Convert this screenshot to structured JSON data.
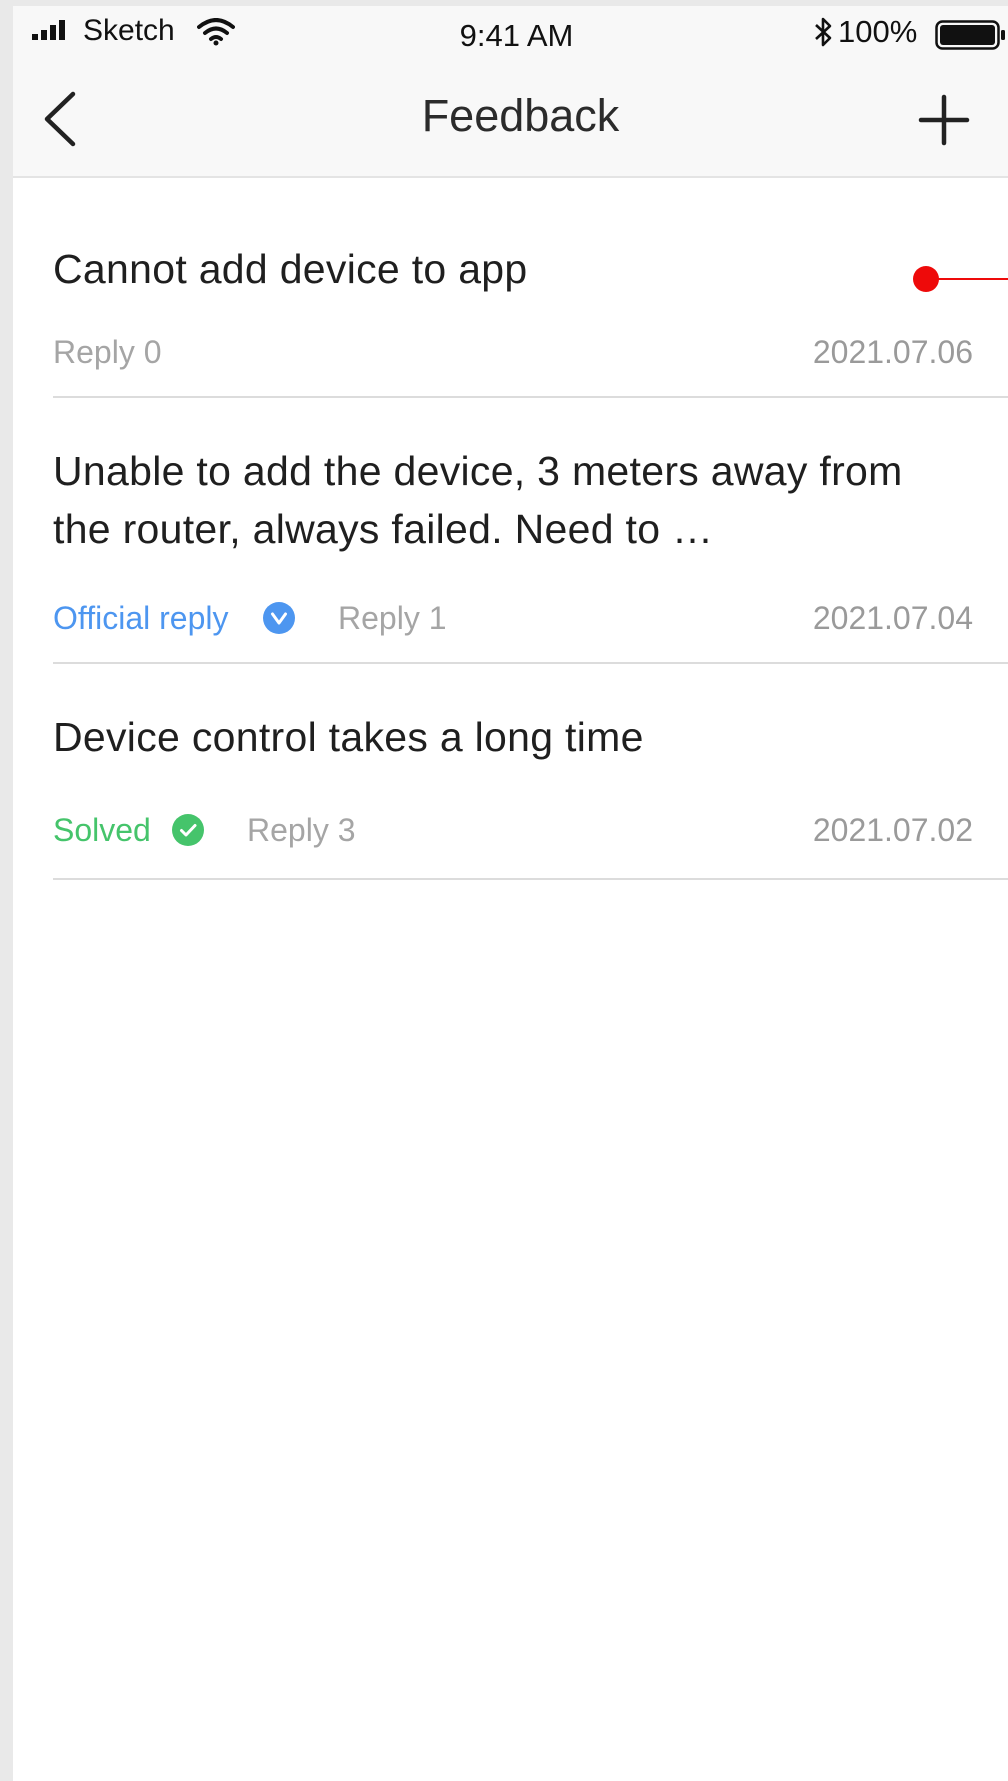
{
  "status_bar": {
    "carrier": "Sketch",
    "time": "9:41 AM",
    "battery": "100%"
  },
  "nav": {
    "title": "Feedback"
  },
  "feedback": [
    {
      "title": "Cannot add device to app",
      "reply": "Reply 0",
      "date": "2021.07.06",
      "unread": true
    },
    {
      "title": "Unable to add the device, 3 meters away from the router, always failed. Need to …",
      "status": "Official reply",
      "status_icon": "check-badge-icon",
      "reply": "Reply 1",
      "date": "2021.07.04"
    },
    {
      "title": "Device control takes a long time",
      "status": "Solved",
      "status_icon": "check-circle-icon",
      "reply": "Reply 3",
      "date": "2021.07.02"
    }
  ],
  "colors": {
    "official": "#4d96f0",
    "solved": "#45c46b",
    "unread": "#ee0a0a"
  }
}
